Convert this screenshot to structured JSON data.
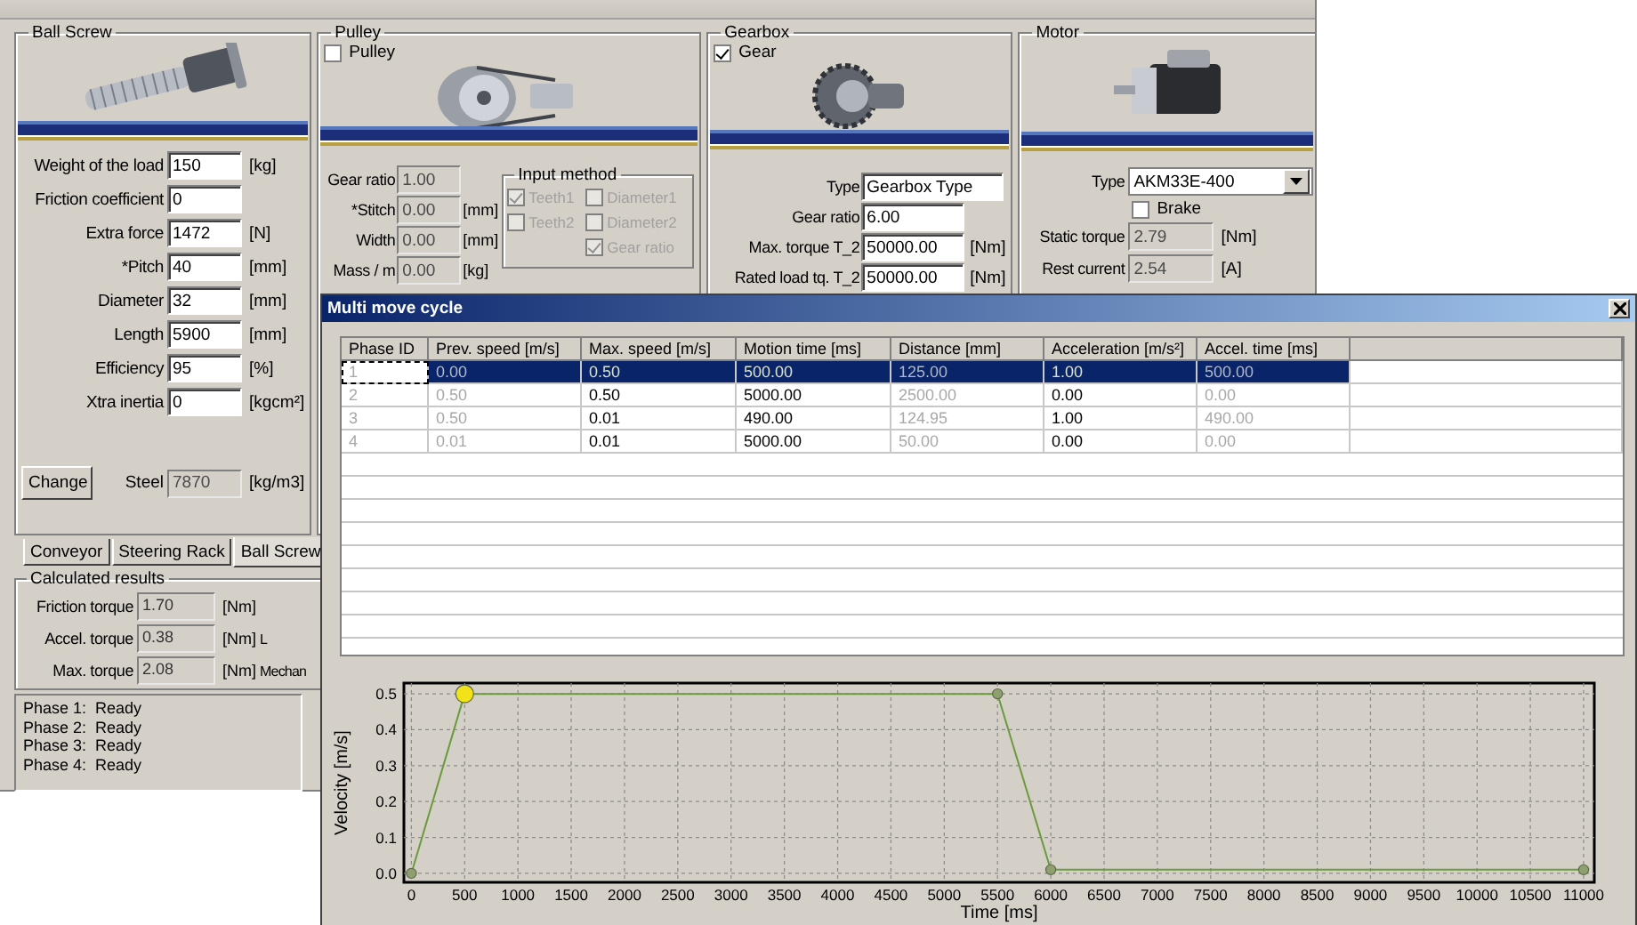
{
  "ball_screw": {
    "title": "Ball Screw",
    "fields": [
      {
        "label": "Weight of the load",
        "value": "150",
        "unit": "[kg]",
        "disabled": false
      },
      {
        "label": "Friction coefficient",
        "value": "0",
        "disabled": false
      },
      {
        "label": "Extra force",
        "value": "1472",
        "unit": "[N]",
        "disabled": false
      },
      {
        "label": "*Pitch",
        "value": "40",
        "unit": "[mm]",
        "disabled": false
      },
      {
        "label": "Diameter",
        "value": "32",
        "unit": "[mm]",
        "disabled": false
      },
      {
        "label": "Length",
        "value": "5900",
        "unit": "[mm]",
        "disabled": false
      },
      {
        "label": "Efficiency",
        "value": "95",
        "unit": "[%]",
        "disabled": false
      },
      {
        "label": "Xtra inertia",
        "value": "0",
        "unit": "[kgcm²]",
        "disabled": false
      }
    ],
    "change_button": "Change",
    "material": {
      "label": "Steel",
      "value": "7870",
      "unit": "[kg/m3]",
      "disabled": true
    }
  },
  "tabs": [
    {
      "label": "Conveyor",
      "selected": false
    },
    {
      "label": "Steering Rack",
      "selected": false
    },
    {
      "label": "Ball Screw",
      "selected": true
    }
  ],
  "calculated_results": {
    "title": "Calculated results",
    "rows": [
      {
        "label": "Friction torque",
        "value": "1.70",
        "unit": "[Nm]"
      },
      {
        "label": "Accel. torque",
        "value": "0.38",
        "unit": "[Nm]",
        "column_4": "L"
      },
      {
        "label": "Max. torque",
        "value": "2.08",
        "unit": "[Nm]",
        "column_4": "Mechan"
      }
    ]
  },
  "status_log": [
    "Phase 1:  Ready",
    "Phase 2:  Ready",
    "Phase 3:  Ready",
    "Phase 4:  Ready"
  ],
  "pulley": {
    "title": "Pulley",
    "checkbox": {
      "label": "Pulley",
      "checked": false
    },
    "fields": [
      {
        "label": "Gear ratio",
        "value": "1.00",
        "disabled": true
      },
      {
        "label": "*Stitch",
        "value": "0.00",
        "unit": "[mm]",
        "disabled": true
      },
      {
        "label": "Width",
        "value": "0.00",
        "unit": "[mm]",
        "disabled": true
      },
      {
        "label": "Mass / m",
        "value": "0.00",
        "unit": "[kg]",
        "disabled": true
      }
    ],
    "input_method": {
      "title": "Input method",
      "options": [
        {
          "label": "Teeth1",
          "checked": true,
          "disabled": true
        },
        {
          "label": "Diameter1",
          "checked": false,
          "disabled": true
        },
        {
          "label": "Teeth2",
          "checked": false,
          "disabled": true
        },
        {
          "label": "Diameter2",
          "checked": false,
          "disabled": true
        },
        {
          "label": "Gear ratio",
          "checked": true,
          "disabled": true
        }
      ]
    }
  },
  "gearbox": {
    "title": "Gearbox",
    "checkbox": {
      "label": "Gear",
      "checked": true
    },
    "fields": [
      {
        "label": "Type",
        "value": "Gearbox Type",
        "disabled": false
      },
      {
        "label": "Gear ratio",
        "value": "6.00",
        "disabled": false
      },
      {
        "label": "Max. torque T_2",
        "value": "50000.00",
        "unit": "[Nm]",
        "disabled": false
      },
      {
        "label": "Rated load tq. T_2",
        "value": "50000.00",
        "unit": "[Nm]",
        "disabled": false
      }
    ]
  },
  "motor": {
    "title": "Motor",
    "type_label": "Type",
    "type_value": "AKM33E-400",
    "brake": {
      "label": "Brake",
      "checked": false
    },
    "fields": [
      {
        "label": "Static torque",
        "value": "2.79",
        "unit": "[Nm]",
        "disabled": true
      },
      {
        "label": "Rest current",
        "value": "2.54",
        "unit": "[A]",
        "disabled": true
      }
    ]
  },
  "dialog": {
    "title": "Multi move cycle",
    "table": {
      "columns": [
        {
          "label": "Phase ID",
          "computed": true
        },
        {
          "label": "Prev. speed [m/s]",
          "computed": true
        },
        {
          "label": "Max. speed [m/s]",
          "computed": false
        },
        {
          "label": "Motion time [ms]",
          "computed": false
        },
        {
          "label": "Distance [mm]",
          "computed": true
        },
        {
          "label": "Acceleration [m/s²]",
          "computed": false
        },
        {
          "label": "Accel. time [ms]",
          "computed": true
        }
      ],
      "rows": [
        {
          "selected": true,
          "cells": [
            "1",
            "0.00",
            "0.50",
            "500.00",
            "125.00",
            "1.00",
            "500.00"
          ]
        },
        {
          "selected": false,
          "cells": [
            "2",
            "0.50",
            "0.50",
            "5000.00",
            "2500.00",
            "0.00",
            "0.00"
          ]
        },
        {
          "selected": false,
          "cells": [
            "3",
            "0.50",
            "0.01",
            "490.00",
            "124.95",
            "1.00",
            "490.00"
          ]
        },
        {
          "selected": false,
          "cells": [
            "4",
            "0.01",
            "0.01",
            "5000.00",
            "50.00",
            "0.00",
            "0.00"
          ]
        }
      ]
    },
    "chart_data": {
      "type": "line",
      "xlabel": "Time [ms]",
      "ylabel": "Velocity [m/s]",
      "x": [
        0,
        500,
        5500,
        6000,
        11000
      ],
      "series": [
        {
          "color": "#6b9a3c",
          "marker": "circle",
          "values": [
            0,
            0.5,
            0.5,
            0.01,
            0.01
          ]
        }
      ],
      "grid": true,
      "xlim": [
        -70,
        11100
      ],
      "ylim": [
        -0.025,
        0.53
      ],
      "xticks": [
        0,
        500,
        1000,
        1500,
        2000,
        2500,
        3000,
        3500,
        4000,
        4500,
        5000,
        5500,
        6000,
        6500,
        7000,
        7500,
        8000,
        8500,
        9000,
        9500,
        10000,
        10500,
        11000
      ],
      "yticks": [
        {
          "value": 0,
          "label": "0.0"
        },
        {
          "value": 0.1,
          "label": "0.1"
        },
        {
          "value": 0.2,
          "label": "0.2"
        },
        {
          "value": 0.3,
          "label": "0.3"
        },
        {
          "value": 0.4,
          "label": "0.4"
        },
        {
          "value": 0.5,
          "label": "0.5"
        }
      ]
    }
  }
}
